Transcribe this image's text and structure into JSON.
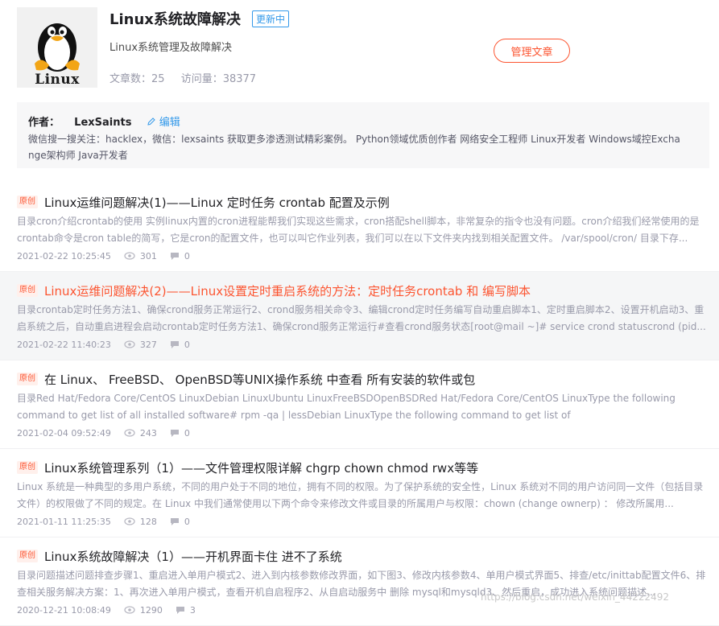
{
  "column": {
    "cover_text": "Linux",
    "title": "Linux系统故障解决",
    "badge": "更新中",
    "description": "Linux系统管理及故障解决",
    "article_count_label": "文章数：25",
    "visits_label": "访问量：38377",
    "manage_button": "管理文章"
  },
  "author": {
    "label": "作者：",
    "name": "LexSaints",
    "edit_label": "编辑",
    "bio_line1": "微信搜一搜关注：hacklex，微信：lexsaints 获取更多渗透测试精彩案例。 Python领域优质创作者 网络安全工程师 Linux开发者 Windows域控Excha",
    "bio_line2": "nge架构师 Java开发者"
  },
  "articles": [
    {
      "tag": "原创",
      "title": "Linux运维问题解决(1)——Linux 定时任务 crontab 配置及示例",
      "excerpt": "目录cron介绍crontab的使用 实例linux内置的cron进程能帮我们实现这些需求，cron搭配shell脚本，非常复杂的指令也没有问题。cron介绍我们经常使用的是crontab命令是cron table的简写，它是cron的配置文件，也可以叫它作业列表，我们可以在以下文件夹内找到相关配置文件。 /var/spool/cron/ 目录下存...",
      "date": "2021-02-22 10:25:45",
      "views": "301",
      "comments": "0"
    },
    {
      "tag": "原创",
      "title": "Linux运维问题解决(2)——Linux设置定时重启系统的方法：定时任务crontab 和 编写脚本",
      "excerpt": "目录crontab定时任务方法1、确保crond服务正常运行2、crond服务相关命令3、编辑crond定时任务编写自动重启脚本1、定时重启脚本2、设置开机启动3、重启系统之后，自动重启进程会启动crontab定时任务方法1、确保crond服务正常运行#查看crond服务状态[root@mail ~]# service crond statuscrond (pid...",
      "date": "2021-02-22 11:40:23",
      "views": "327",
      "comments": "0"
    },
    {
      "tag": "原创",
      "title": "在 Linux、 FreeBSD、 OpenBSD等UNIX操作系统 中查看 所有安装的软件或包",
      "excerpt": "目录Red Hat/Fedora Core/CentOS LinuxDebian LinuxUbuntu LinuxFreeBSDOpenBSDRed Hat/Fedora Core/CentOS LinuxType the following command to get list of all installed software# rpm -qa | lessDebian LinuxType the following command to get list of",
      "date": "2021-02-04 09:52:49",
      "views": "243",
      "comments": "0"
    },
    {
      "tag": "原创",
      "title": "Linux系统管理系列（1）——文件管理权限详解 chgrp chown chmod rwx等等",
      "excerpt": "Linux 系统是一种典型的多用户系统，不同的用户处于不同的地位，拥有不同的权限。为了保护系统的安全性，Linux 系统对不同的用户访问同一文件（包括目录文件）的权限做了不同的规定。在 Linux 中我们通常使用以下两个命令来修改文件或目录的所属用户与权限：chown (change ownerp) ： 修改所属用...",
      "date": "2021-01-11 11:25:35",
      "views": "128",
      "comments": "0"
    },
    {
      "tag": "原创",
      "title": "Linux系统故障解决（1）——开机界面卡住 进不了系统",
      "excerpt": "目录问题描述问题排查步骤1、重启进入单用户模式2、进入到内核参数修改界面，如下图3、修改内核参数4、单用户模式界面5、排查/etc/inittab配置文件6、排查相关服务解决方案：1、再次进入单用户模式，查看开机自启程序2、从自启动服务中 删除 mysql和mysqld3、然后重启，成功进入系统问题描述...",
      "date": "2020-12-21 10:08:49",
      "views": "1290",
      "comments": "3"
    }
  ],
  "watermark": "https://blog.csdn.net/weixin_44222492"
}
